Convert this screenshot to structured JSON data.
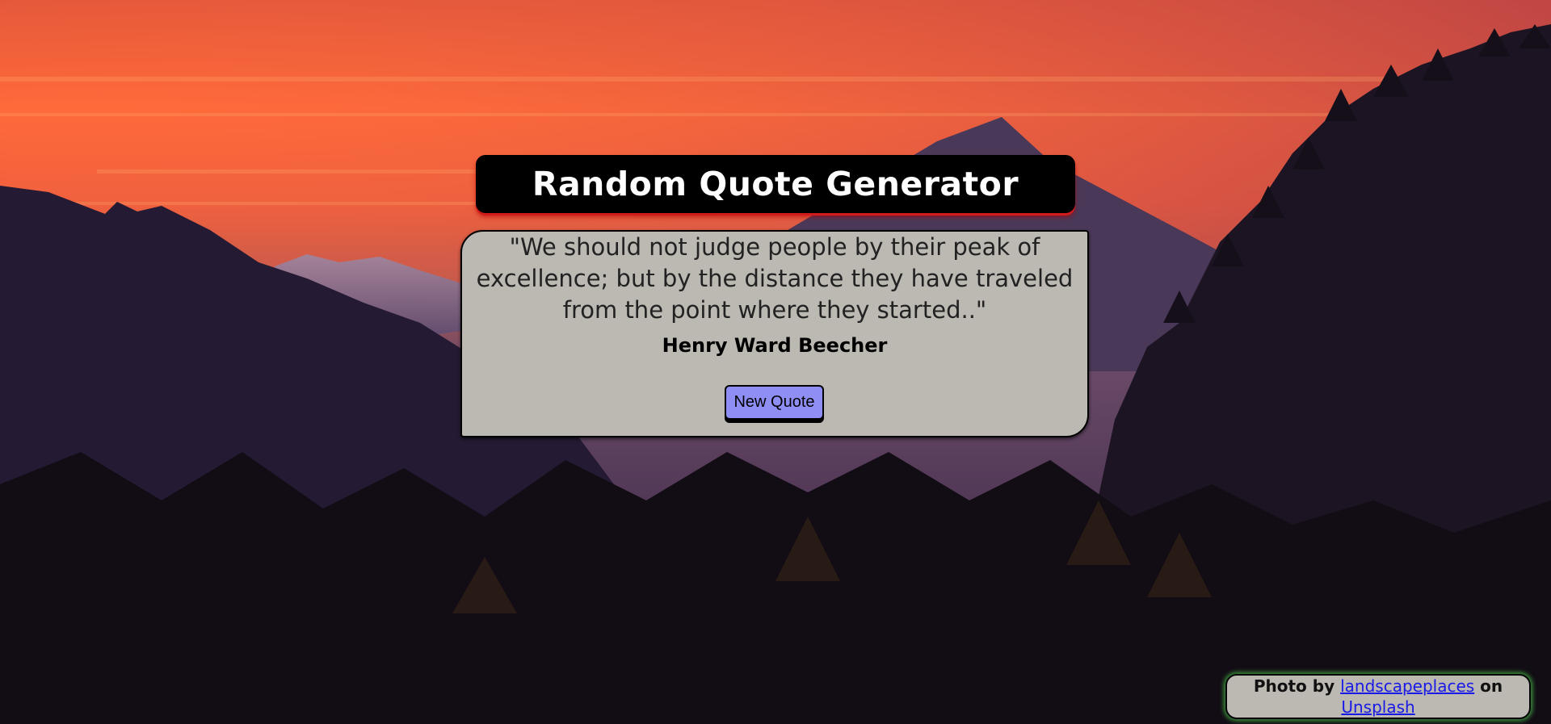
{
  "app": {
    "title": "Random Quote Generator"
  },
  "quote": {
    "text": "\"We should not judge people by their peak of excellence; but by the distance they have traveled from the point where they started..\"",
    "author": "Henry Ward Beecher"
  },
  "controls": {
    "new_quote_label": "New Quote"
  },
  "credit": {
    "prefix": "Photo by",
    "photographer": "landscapeplaces",
    "middle": "on",
    "site": "Unsplash"
  },
  "colors": {
    "title_bg": "#000000",
    "title_glow": "#d41b1b",
    "card_bg": "#bcb8b2",
    "button_bg": "#8e8ef5",
    "credit_glow": "#3f9c3f",
    "link": "#1a1ae6"
  },
  "icons": {
    "background": "mountain-sunset-photo"
  }
}
